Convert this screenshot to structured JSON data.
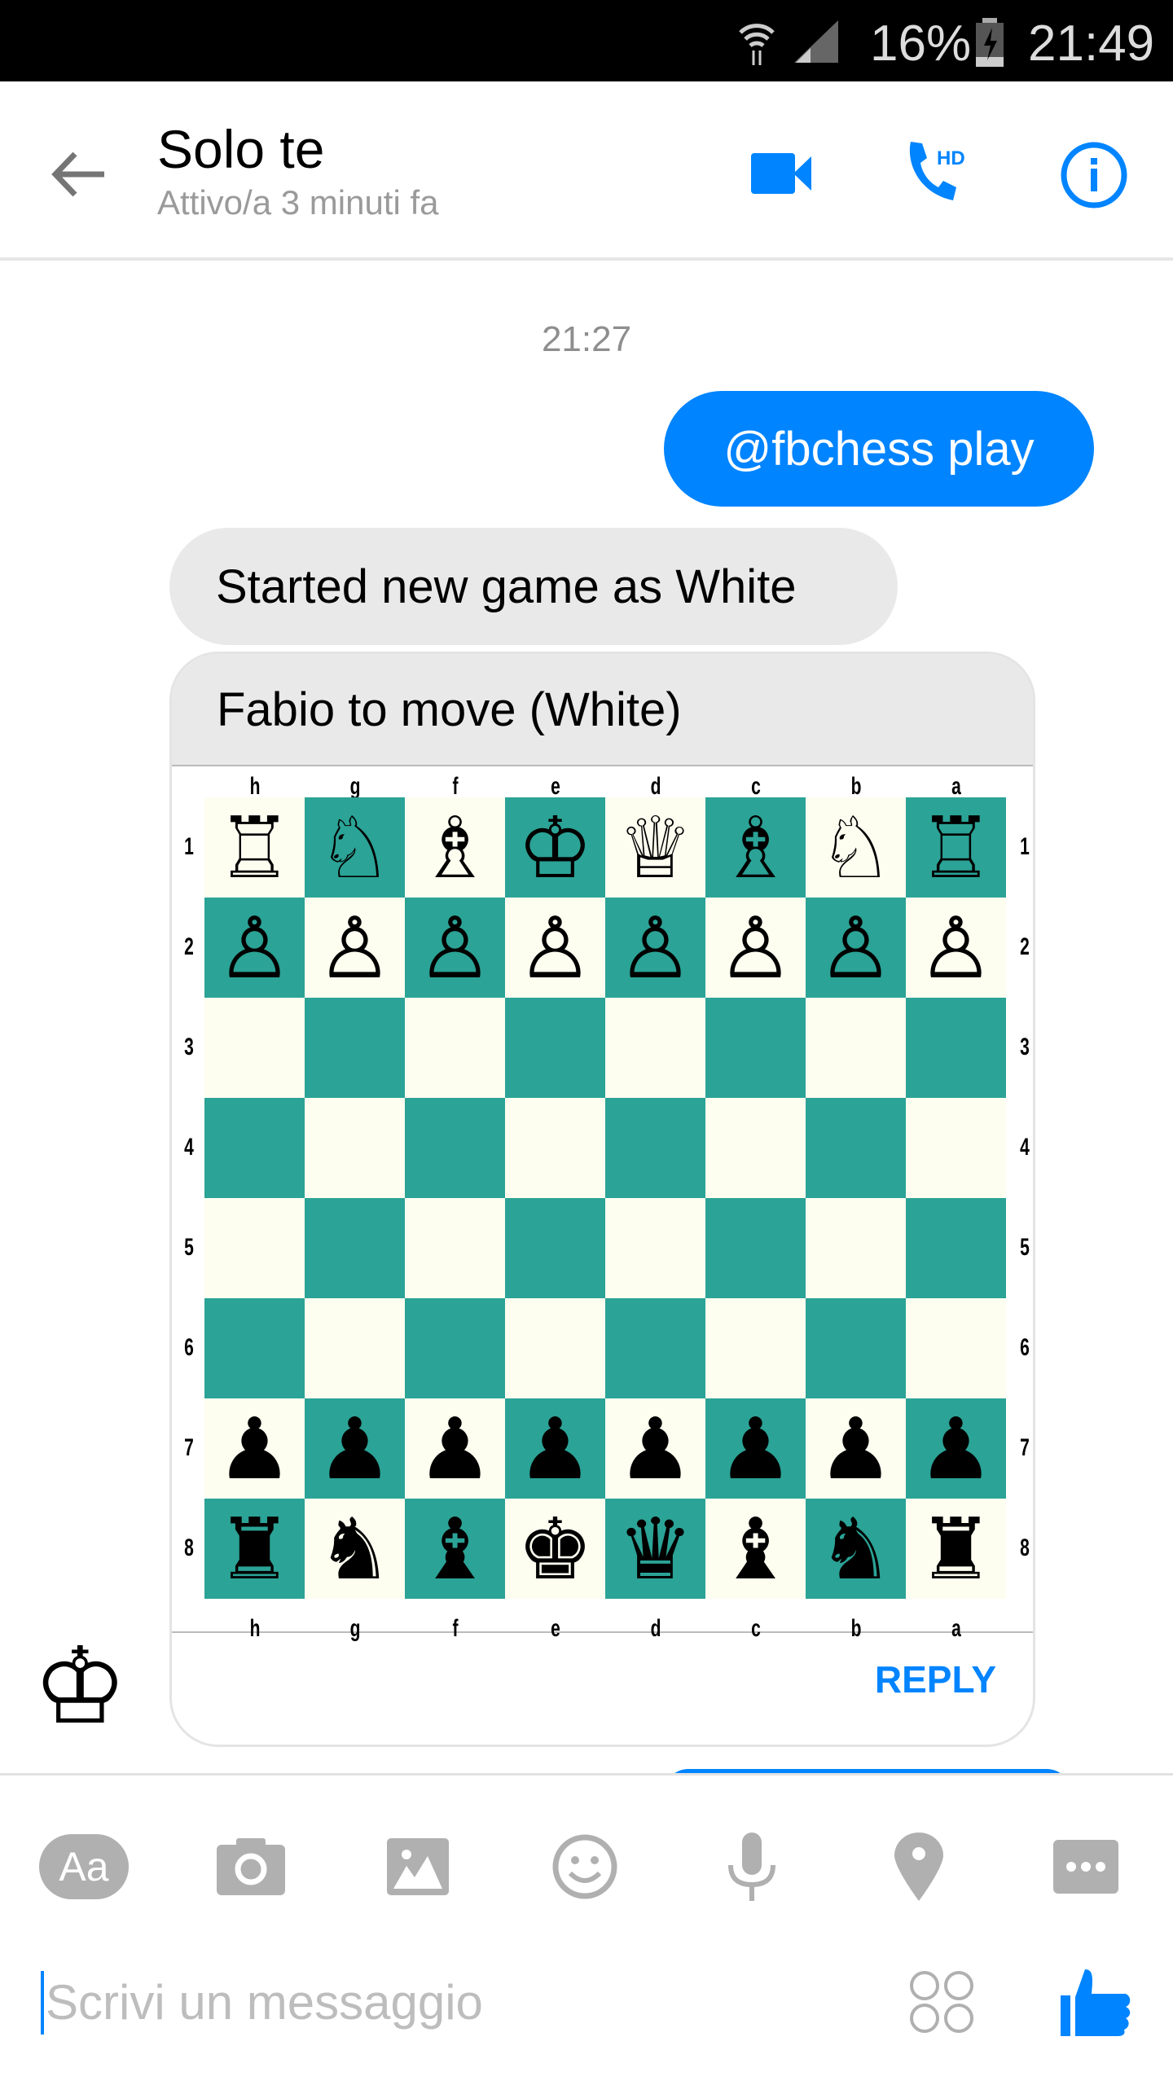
{
  "status_bar": {
    "battery": "16%",
    "time": "21:49",
    "icons": [
      "wifi-icon",
      "signal-icon",
      "battery-charging-icon"
    ]
  },
  "header": {
    "title": "Solo te",
    "subtitle": "Attivo/a 3 minuti fa",
    "icons": [
      "back-arrow-icon",
      "video-call-icon",
      "hd-phone-call-icon",
      "info-icon"
    ],
    "hd_label": "HD",
    "accent": "#0084ff"
  },
  "conversation": {
    "timestamp": "21:27",
    "outgoing": "@fbchess play",
    "incoming": "Started new game as White",
    "card": {
      "header": "Fabio to move (White)",
      "reply_label": "REPLY",
      "files": [
        "h",
        "g",
        "f",
        "e",
        "d",
        "c",
        "b",
        "a"
      ],
      "ranks": [
        "1",
        "2",
        "3",
        "4",
        "5",
        "6",
        "7",
        "8"
      ],
      "board": [
        "♖♘♗♔♕♗♘♖",
        "♙♙♙♙♙♙♙♙",
        "        ",
        "        ",
        "        ",
        "        ",
        "♟♟♟♟♟♟♟♟",
        "♜♞♝♚♛♝♞♜"
      ],
      "colors": {
        "dark": "#2ba396",
        "light": "#fdfef0"
      }
    },
    "avatar": "♔"
  },
  "composer": {
    "placeholder": "Scrivi un messaggio",
    "text_tool": "Aa",
    "tools": [
      "text-format-icon",
      "camera-icon",
      "image-icon",
      "emoji-icon",
      "microphone-icon",
      "location-pin-icon",
      "more-icon"
    ],
    "icons": [
      "stickers-icon",
      "thumbs-up-icon"
    ]
  }
}
